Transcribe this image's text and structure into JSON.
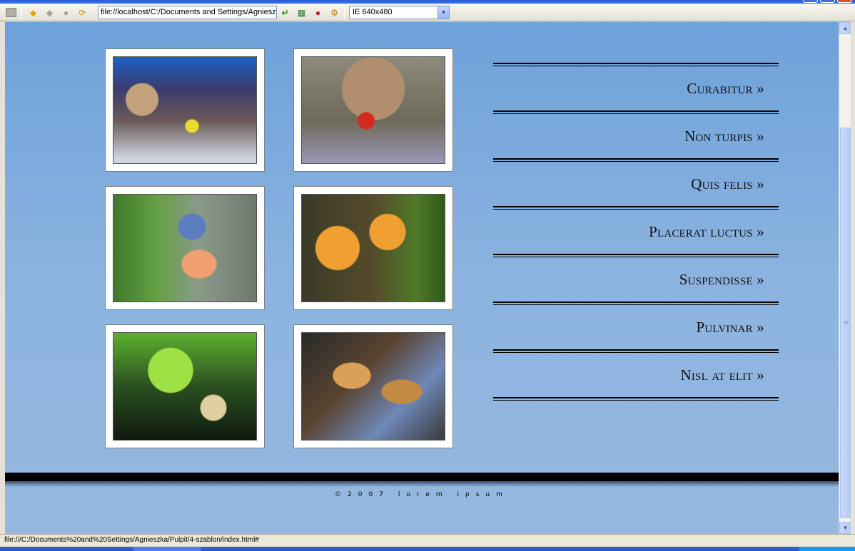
{
  "toolbar": {
    "address": "file://localhost/C:/Documents and Settings/Agniesz",
    "viewport_size": "IE 640x480",
    "icons": [
      "panel-icon",
      "back-icon",
      "forward-icon",
      "stop-icon",
      "refresh-icon",
      "validate-icon",
      "table-icon",
      "error-icon",
      "options-icon"
    ]
  },
  "page": {
    "menu": [
      {
        "label": "Curabitur »"
      },
      {
        "label": "Non turpis »"
      },
      {
        "label": "Quis felis »"
      },
      {
        "label": "Placerat luctus »"
      },
      {
        "label": "Suspendisse »"
      },
      {
        "label": "Pulvinar »"
      },
      {
        "label": "Nisl at elit »"
      }
    ],
    "copyright": "©2007 lorem ipsum"
  },
  "status": {
    "text": "file:///C:/Documents%20and%20Settings/Agnieszka/Pulpit/4-szablon/index.html#"
  },
  "colors": {
    "page_bg_top": "#6da1d9",
    "page_bg_bottom": "#95b8df",
    "footer_bar": "#000000"
  }
}
